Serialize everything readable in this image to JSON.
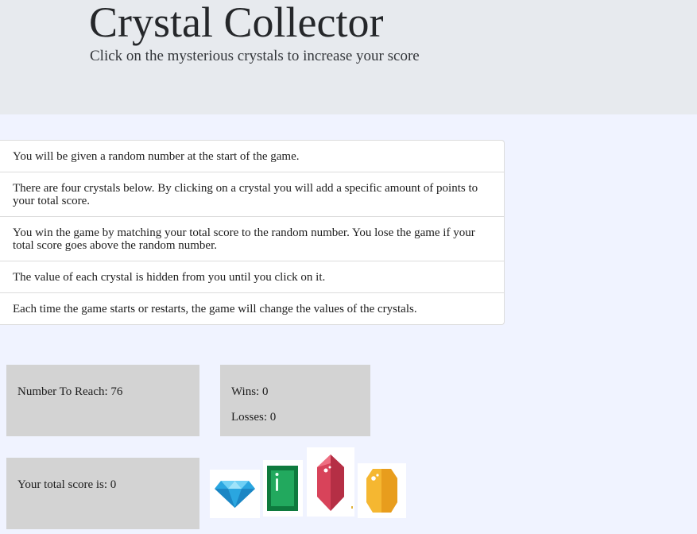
{
  "header": {
    "title": "Crystal Collector",
    "subtitle": "Click on the mysterious crystals to increase your score"
  },
  "rules": [
    "You will be given a random number at the start of the game.",
    "There are four crystals below. By clicking on a crystal you will add a specific amount of points to your total score.",
    "You win the game by matching your total score to the random number. You lose the game if your total score goes above the random number.",
    "The value of each crystal is hidden from you until you click on it.",
    "Each time the game starts or restarts, the game will change the values of the crystals."
  ],
  "target": {
    "label": "Number To Reach: 76"
  },
  "record": {
    "wins_label": "Wins: 0",
    "losses_label": "Losses: 0"
  },
  "score": {
    "label": "Your total score is: 0"
  },
  "crystals": [
    {
      "icon": "blue-diamond-icon",
      "color": "#2aa6e0"
    },
    {
      "icon": "green-emerald-icon",
      "color": "#1e9e5a"
    },
    {
      "icon": "red-ruby-icon",
      "color": "#d8435a"
    },
    {
      "icon": "yellow-topaz-icon",
      "color": "#f5b731"
    }
  ]
}
